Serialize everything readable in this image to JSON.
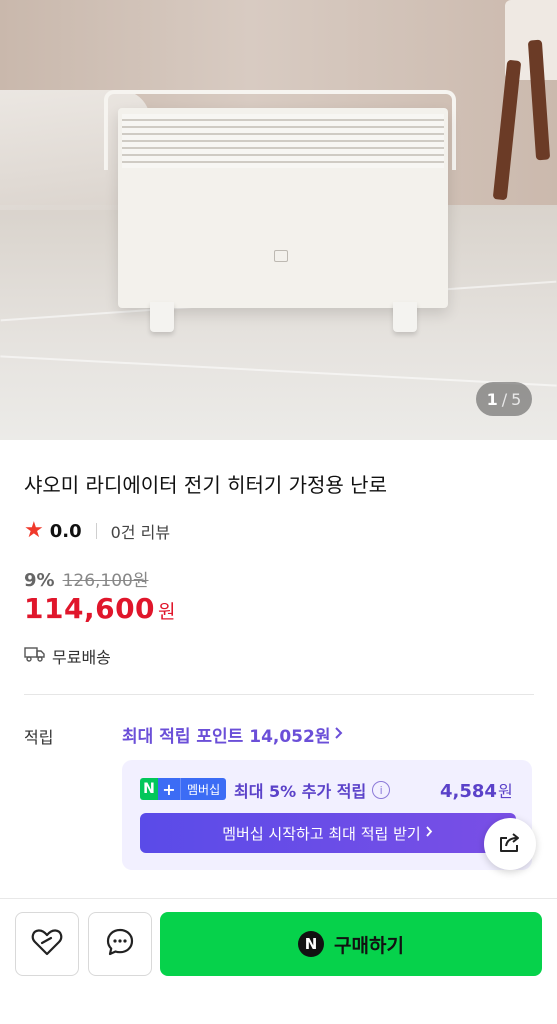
{
  "hero": {
    "counter_current": "1",
    "counter_separator": "/",
    "counter_total": "5"
  },
  "product": {
    "title": "샤오미 라디에이터 전기 히터기 가정용 난로",
    "rating": "0.0",
    "reviews": "0건 리뷰",
    "discount": "9%",
    "original_price": "126,100원",
    "price": "114,600",
    "price_unit": "원",
    "shipping": "무료배송"
  },
  "points": {
    "label": "적립",
    "max_text": "최대 적립 포인트 14,052원",
    "badge_n": "N",
    "badge_plus": "+",
    "badge_label": "멤버십",
    "extra_text": "최대 5% 추가 적립",
    "extra_amount": "4,584",
    "extra_amount_unit": "원",
    "cta": "멤버십 시작하고 최대 적립 받기"
  },
  "bottom_bar": {
    "buy_label": "구매하기",
    "npay_glyph": "N"
  },
  "icons": {
    "star": "star-icon",
    "truck": "truck-icon",
    "chevron": "chevron-right-icon",
    "info": "info-icon",
    "share": "share-icon",
    "heart": "heart-icon",
    "chat": "chat-icon"
  },
  "colors": {
    "price_red": "#e0162b",
    "accent_purple": "#6b4fd8",
    "buy_green": "#06d24b",
    "star_red": "#f0392b"
  }
}
